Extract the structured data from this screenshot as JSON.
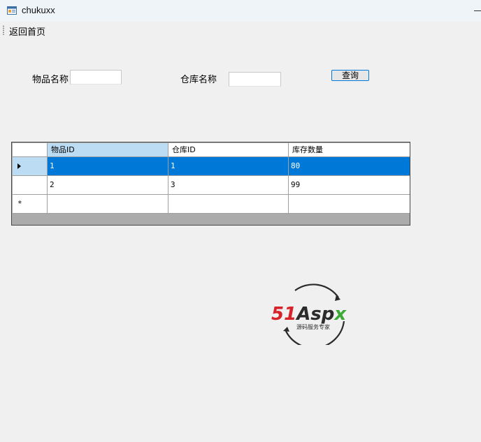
{
  "window": {
    "title": "chukuxx"
  },
  "menu": {
    "items": [
      {
        "label": "返回首页"
      }
    ]
  },
  "search": {
    "item_name_label": "物品名称",
    "item_name_value": "",
    "warehouse_name_label": "仓库名称",
    "warehouse_name_value": "",
    "query_button": "查询"
  },
  "grid": {
    "columns": [
      "物品ID",
      "仓库ID",
      "库存数量"
    ],
    "rows": [
      {
        "item_id": "1",
        "warehouse_id": "1",
        "quantity": "80",
        "selected": true
      },
      {
        "item_id": "2",
        "warehouse_id": "3",
        "quantity": "99",
        "selected": false
      }
    ],
    "new_row_marker": "*"
  },
  "watermark": {
    "logo_text": "51Aspx",
    "tagline": "源码服务专家"
  },
  "colors": {
    "selection": "#0078d7",
    "header_active": "#bcdcf4",
    "logo_red": "#d6232a",
    "logo_green": "#3aa935"
  }
}
